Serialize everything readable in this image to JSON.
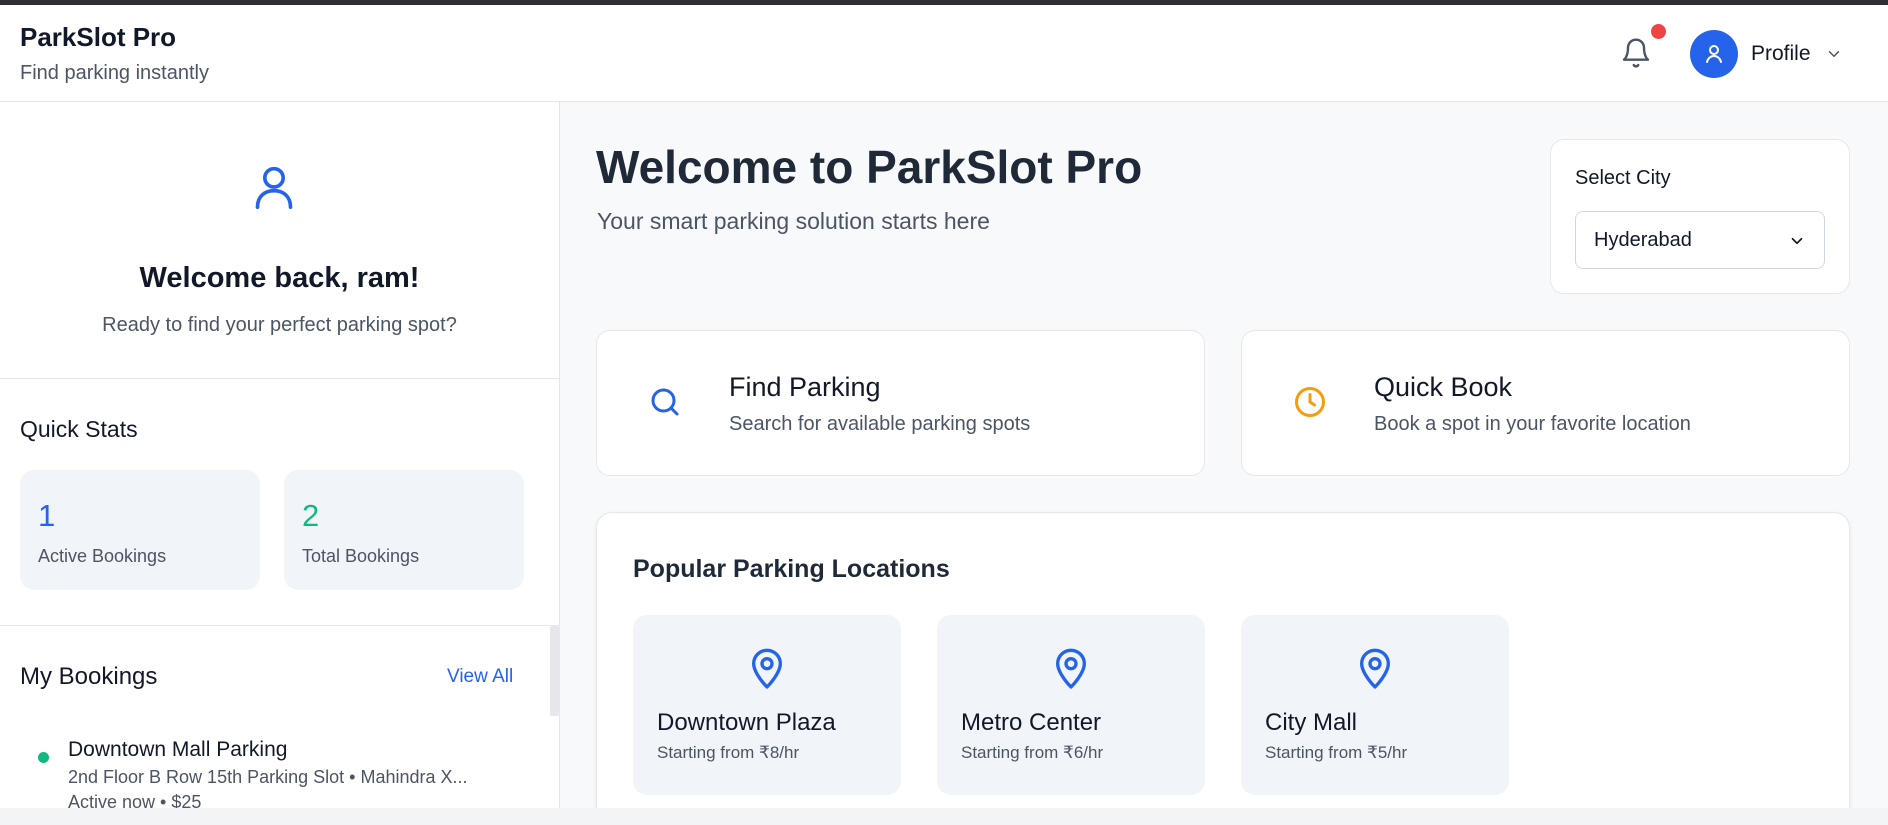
{
  "header": {
    "title": "ParkSlot Pro",
    "subtitle": "Find parking instantly",
    "profile_label": "Profile"
  },
  "sidebar": {
    "welcome_title": "Welcome back, ram!",
    "welcome_sub": "Ready to find your perfect parking spot?",
    "stats_title": "Quick Stats",
    "stats": [
      {
        "value": "1",
        "label": "Active Bookings",
        "color": "#2563eb"
      },
      {
        "value": "2",
        "label": "Total Bookings",
        "color": "#10b981"
      }
    ],
    "bookings_title": "My Bookings",
    "view_all": "View All",
    "bookings": [
      {
        "title": "Downtown Mall Parking",
        "detail": "2nd Floor B Row 15th Parking Slot • Mahindra X...",
        "status": "Active now • $25"
      }
    ]
  },
  "main": {
    "title": "Welcome to ParkSlot Pro",
    "subtitle": "Your smart parking solution starts here",
    "city": {
      "label": "Select City",
      "value": "Hyderabad"
    },
    "actions": [
      {
        "title": "Find Parking",
        "sub": "Search for available parking spots",
        "icon": "search-icon",
        "color": "#2563eb"
      },
      {
        "title": "Quick Book",
        "sub": "Book a spot in your favorite location",
        "icon": "clock-icon",
        "color": "#f59e0b"
      }
    ],
    "popular_title": "Popular Parking Locations",
    "locations": [
      {
        "name": "Downtown Plaza",
        "price": "Starting from ₹8/hr"
      },
      {
        "name": "Metro Center",
        "price": "Starting from ₹6/hr"
      },
      {
        "name": "City Mall",
        "price": "Starting from ₹5/hr"
      }
    ]
  },
  "colors": {
    "accent": "#2563eb",
    "success": "#10b981",
    "warning": "#f59e0b",
    "alert": "#ef4444"
  }
}
